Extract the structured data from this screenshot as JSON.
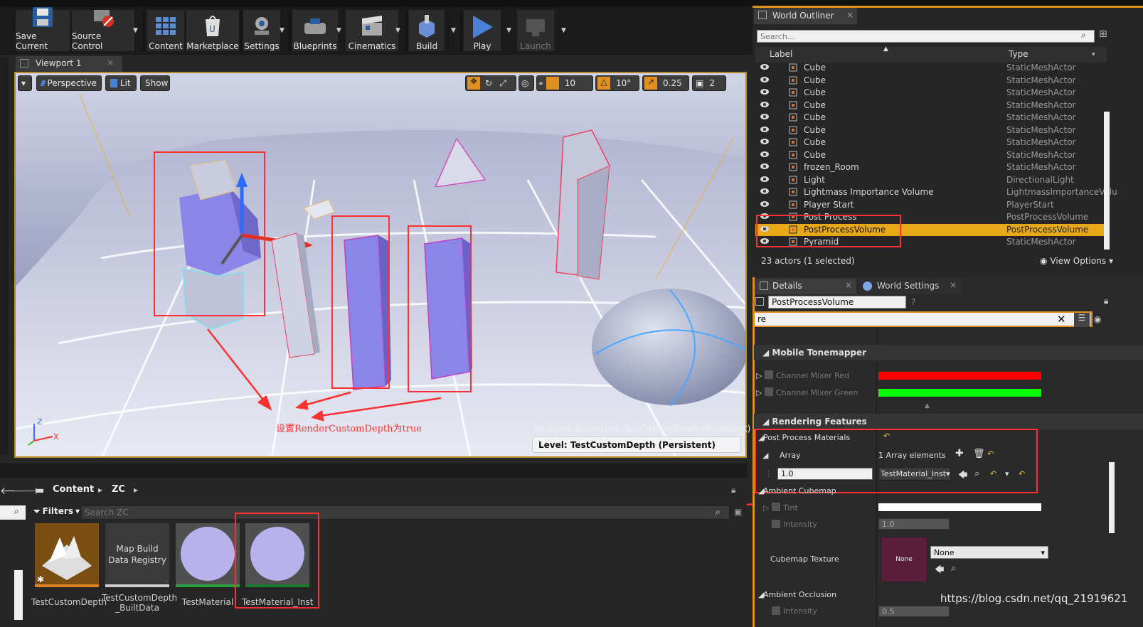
{
  "toolbar": {
    "items": [
      {
        "label": "Save Current",
        "icon": "save-icon"
      },
      {
        "label": "Source Control",
        "icon": "source-control-icon"
      },
      {
        "label": "Content",
        "icon": "content-icon"
      },
      {
        "label": "Marketplace",
        "icon": "marketplace-icon"
      },
      {
        "label": "Settings",
        "icon": "settings-icon"
      },
      {
        "label": "Blueprints",
        "icon": "blueprints-icon"
      },
      {
        "label": "Cinematics",
        "icon": "cinematics-icon"
      },
      {
        "label": "Build",
        "icon": "build-icon"
      },
      {
        "label": "Play",
        "icon": "play-icon"
      },
      {
        "label": "Launch",
        "icon": "launch-icon"
      }
    ]
  },
  "viewport": {
    "tab_label": "Viewport 1",
    "perspective": "Perspective",
    "lit": "Lit",
    "show": "Show",
    "grid_snap": "10",
    "rot_snap": "10°",
    "scale_snap": "0.25",
    "camera_speed": "2",
    "annotation": "设置RenderCustomDepth为true",
    "selected_actor": "Selected Actor(s) in:  TestCustomDepth (Persistent)",
    "level": "Level:  TestCustomDepth (Persistent)",
    "axis_z": "Z",
    "axis_x": "X"
  },
  "outliner": {
    "tab_label": "World Outliner",
    "search_placeholder": "Search...",
    "col_label": "Label",
    "col_type": "Type",
    "rows": [
      {
        "label": "Cube",
        "type": "StaticMeshActor"
      },
      {
        "label": "Cube",
        "type": "StaticMeshActor"
      },
      {
        "label": "Cube",
        "type": "StaticMeshActor"
      },
      {
        "label": "Cube",
        "type": "StaticMeshActor"
      },
      {
        "label": "Cube",
        "type": "StaticMeshActor"
      },
      {
        "label": "Cube",
        "type": "StaticMeshActor"
      },
      {
        "label": "Cube",
        "type": "StaticMeshActor"
      },
      {
        "label": "Cube",
        "type": "StaticMeshActor"
      },
      {
        "label": "frozen_Room",
        "type": "StaticMeshActor"
      },
      {
        "label": "Light",
        "type": "DirectionalLight"
      },
      {
        "label": "Lightmass Importance Volume",
        "type": "LightmassImportanceVolu"
      },
      {
        "label": "Player Start",
        "type": "PlayerStart"
      },
      {
        "label": "Post Process",
        "type": "PostProcessVolume"
      },
      {
        "label": "PostProcessVolume",
        "type": "PostProcessVolume"
      },
      {
        "label": "Pyramid",
        "type": "StaticMeshActor"
      }
    ],
    "status": "23 actors (1 selected)",
    "view_options": "View Options"
  },
  "details": {
    "tab_details": "Details",
    "tab_world_settings": "World Settings",
    "object_name": "PostProcessVolume",
    "search_value": "re",
    "mobile_tonemapper": "Mobile Tonemapper",
    "channel_mixer_red": "Channel Mixer Red",
    "channel_mixer_green": "Channel Mixer Green",
    "rendering_features": "Rendering Features",
    "post_process_materials": "Post Process Materials",
    "array": "Array",
    "array_elements": "1 Array elements",
    "weight_value": "1.0",
    "material_value": "TestMaterial_Inst",
    "ambient_cubemap": "Ambient Cubemap",
    "tint": "Tint",
    "intensity": "Intensity",
    "intensity_value": "1.0",
    "cubemap_texture": "Cubemap Texture",
    "none_thumb": "None",
    "none_select": "None",
    "ambient_occlusion": "Ambient Occlusion",
    "ao_intensity": "Intensity",
    "ao_value": "0.5",
    "colors": {
      "red": "#ff0000",
      "green": "#00ff00"
    }
  },
  "content_browser": {
    "path_root": "Content",
    "path_folder": "ZC",
    "filters": "Filters",
    "search_placeholder": "Search ZC",
    "assets": [
      {
        "label": "TestCustomDepth",
        "thumb": ""
      },
      {
        "label": "TestCustomDepth _BuiltData",
        "thumb": "Map Build Data Registry"
      },
      {
        "label": "TestMaterial",
        "thumb": ""
      },
      {
        "label": "TestMaterial_Inst",
        "thumb": ""
      }
    ]
  },
  "watermark": "https://blog.csdn.net/qq_21919621"
}
